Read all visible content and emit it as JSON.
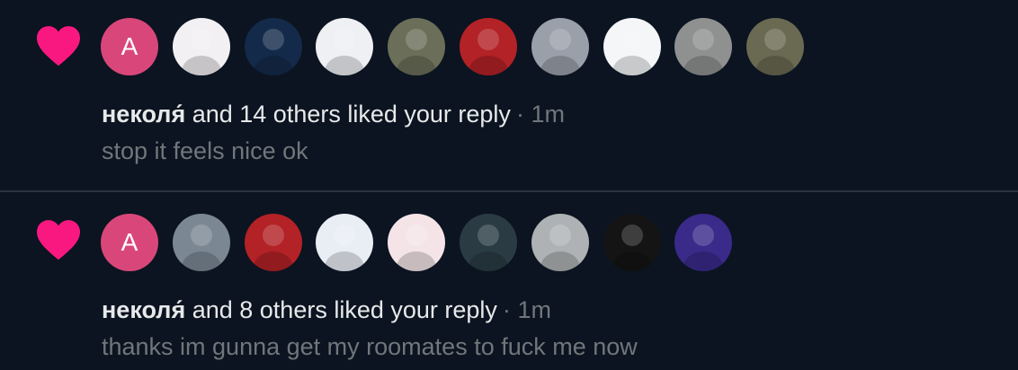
{
  "colors": {
    "background": "#0b1420",
    "heart": "#f91880",
    "primary_text": "#e7e9ea",
    "secondary_text": "#71767b",
    "divider": "#2c3340",
    "letter_avatar": "#d9477a"
  },
  "notifications": [
    {
      "icon": "heart-icon",
      "name": "неколя́",
      "action": " and 14 others liked your reply",
      "separator": "·",
      "time": "1m",
      "reply_text": "stop it feels nice ok",
      "avatars": [
        {
          "kind": "letter",
          "letter": "A",
          "color": "#d9477a"
        },
        {
          "kind": "image",
          "color": "#f3f0f4"
        },
        {
          "kind": "image",
          "color": "#142a4a"
        },
        {
          "kind": "image",
          "color": "#eef0f4"
        },
        {
          "kind": "image",
          "color": "#6b6e58"
        },
        {
          "kind": "image",
          "color": "#b32226"
        },
        {
          "kind": "image",
          "color": "#9aa0aa"
        },
        {
          "kind": "image",
          "color": "#f4f6f8"
        },
        {
          "kind": "image",
          "color": "#8f9190"
        },
        {
          "kind": "image",
          "color": "#6a6a52"
        }
      ]
    },
    {
      "icon": "heart-icon",
      "name": "неколя́",
      "action": " and 8 others liked your reply",
      "separator": "·",
      "time": "1m",
      "reply_text": "thanks im gunna get my roomates to fuck me now",
      "avatars": [
        {
          "kind": "letter",
          "letter": "A",
          "color": "#d9477a"
        },
        {
          "kind": "image",
          "color": "#7b8894"
        },
        {
          "kind": "image",
          "color": "#b32226"
        },
        {
          "kind": "image",
          "color": "#e9edf4"
        },
        {
          "kind": "image",
          "color": "#f4e4e8"
        },
        {
          "kind": "image",
          "color": "#2a3b44"
        },
        {
          "kind": "image",
          "color": "#aeb2b4"
        },
        {
          "kind": "image",
          "color": "#141414"
        },
        {
          "kind": "image",
          "color": "#3a2a8a"
        }
      ]
    }
  ]
}
